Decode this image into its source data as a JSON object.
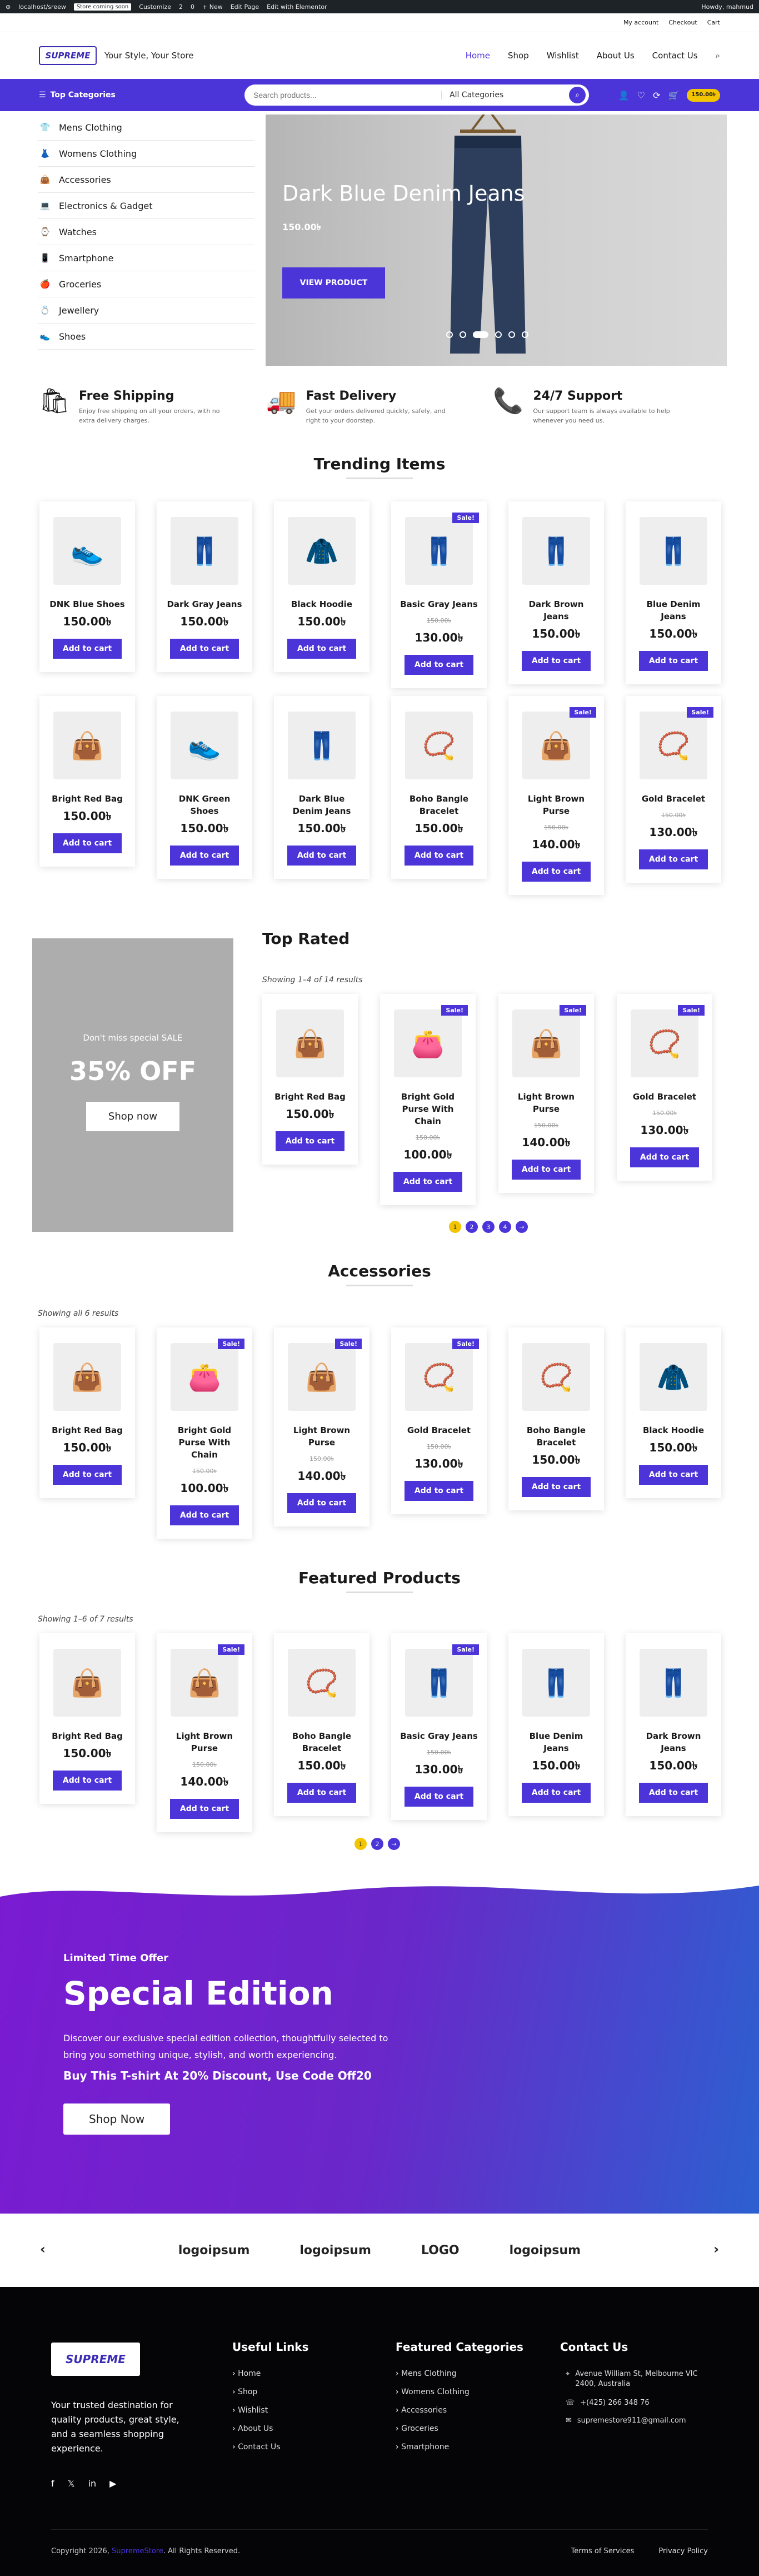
{
  "adminbar": {
    "site": "localhost/sreew",
    "badge": "Store coming soon",
    "customize": "Customize",
    "updates": "2",
    "comments": "0",
    "new": "+ New",
    "edit_page": "Edit Page",
    "elementor": "Edit with Elementor",
    "howdy": "Howdy, mahmud"
  },
  "util": {
    "my_account": "My account",
    "checkout": "Checkout",
    "cart": "Cart"
  },
  "header": {
    "logo": "SUPREME",
    "tagline": "Your Style, Your Store",
    "nav": [
      "Home",
      "Shop",
      "Wishlist",
      "About Us",
      "Contact Us"
    ]
  },
  "catbar": {
    "top_categories": "Top Categories",
    "search_placeholder": "Search products...",
    "select": "All Categories",
    "cart_amount": "150.00৳"
  },
  "categories": [
    {
      "label": "Mens Clothing",
      "icon": "👕"
    },
    {
      "label": "Womens Clothing",
      "icon": "👗"
    },
    {
      "label": "Accessories",
      "icon": "👜"
    },
    {
      "label": "Electronics & Gadget",
      "icon": "💻"
    },
    {
      "label": "Watches",
      "icon": "⌚"
    },
    {
      "label": "Smartphone",
      "icon": "📱"
    },
    {
      "label": "Groceries",
      "icon": "🍎"
    },
    {
      "label": "Jewellery",
      "icon": "💍"
    },
    {
      "label": "Shoes",
      "icon": "👟"
    }
  ],
  "hero": {
    "title": "Dark Blue Denim Jeans",
    "price": "150.00৳",
    "button": "VIEW PRODUCT"
  },
  "features": [
    {
      "title": "Free Shipping",
      "desc": "Enjoy free shipping on all your orders, with no extra delivery charges.",
      "icon": "🛍"
    },
    {
      "title": "Fast Delivery",
      "desc": "Get your orders delivered quickly, safely, and right to your doorstep.",
      "icon": "🚚"
    },
    {
      "title": "24/7 Support",
      "desc": "Our support team is always available to help whenever you need us.",
      "icon": "📞"
    }
  ],
  "trending": {
    "title": "Trending Items",
    "products": [
      {
        "name": "DNK Blue Shoes",
        "price": "150.00৳",
        "old": "",
        "sale": false,
        "icon": "👟"
      },
      {
        "name": "Dark Gray Jeans",
        "price": "150.00৳",
        "old": "",
        "sale": false,
        "icon": "👖"
      },
      {
        "name": "Black Hoodie",
        "price": "150.00৳",
        "old": "",
        "sale": false,
        "icon": "🧥"
      },
      {
        "name": "Basic Gray Jeans",
        "price": "130.00৳",
        "old": "150.00৳",
        "sale": true,
        "icon": "👖"
      },
      {
        "name": "Dark Brown Jeans",
        "price": "150.00৳",
        "old": "",
        "sale": false,
        "icon": "👖"
      },
      {
        "name": "Blue Denim Jeans",
        "price": "150.00৳",
        "old": "",
        "sale": false,
        "icon": "👖"
      },
      {
        "name": "Bright Red Bag",
        "price": "150.00৳",
        "old": "",
        "sale": false,
        "icon": "👜"
      },
      {
        "name": "DNK Green Shoes",
        "price": "150.00৳",
        "old": "",
        "sale": false,
        "icon": "👟"
      },
      {
        "name": "Dark Blue Denim Jeans",
        "price": "150.00৳",
        "old": "",
        "sale": false,
        "icon": "👖"
      },
      {
        "name": "Boho Bangle Bracelet",
        "price": "150.00৳",
        "old": "",
        "sale": false,
        "icon": "📿"
      },
      {
        "name": "Light Brown Purse",
        "price": "140.00৳",
        "old": "150.00৳",
        "sale": true,
        "icon": "👜"
      },
      {
        "name": "Gold Bracelet",
        "price": "130.00৳",
        "old": "150.00৳",
        "sale": true,
        "icon": "📿"
      }
    ]
  },
  "promo": {
    "text": "Don't miss special SALE",
    "percent": "35% OFF",
    "button": "Shop now"
  },
  "top_rated": {
    "title": "Top Rated",
    "showing": "Showing 1–4 of 14 results",
    "products": [
      {
        "name": "Bright Red Bag",
        "price": "150.00৳",
        "old": "",
        "sale": false,
        "icon": "👜"
      },
      {
        "name": "Bright Gold Purse With Chain",
        "price": "100.00৳",
        "old": "150.00৳",
        "sale": true,
        "icon": "👛"
      },
      {
        "name": "Light Brown Purse",
        "price": "140.00৳",
        "old": "150.00৳",
        "sale": true,
        "icon": "👜"
      },
      {
        "name": "Gold Bracelet",
        "price": "130.00৳",
        "old": "150.00৳",
        "sale": true,
        "icon": "📿"
      }
    ],
    "pages": [
      "1",
      "2",
      "3",
      "4",
      "→"
    ]
  },
  "accessories": {
    "title": "Accessories",
    "showing": "Showing all 6 results",
    "products": [
      {
        "name": "Bright Red Bag",
        "price": "150.00৳",
        "old": "",
        "sale": false,
        "icon": "👜"
      },
      {
        "name": "Bright Gold Purse With Chain",
        "price": "100.00৳",
        "old": "150.00৳",
        "sale": true,
        "icon": "👛"
      },
      {
        "name": "Light Brown Purse",
        "price": "140.00৳",
        "old": "150.00৳",
        "sale": true,
        "icon": "👜"
      },
      {
        "name": "Gold Bracelet",
        "price": "130.00৳",
        "old": "150.00৳",
        "sale": true,
        "icon": "📿"
      },
      {
        "name": "Boho Bangle Bracelet",
        "price": "150.00৳",
        "old": "",
        "sale": false,
        "icon": "📿"
      },
      {
        "name": "Black Hoodie",
        "price": "150.00৳",
        "old": "",
        "sale": false,
        "icon": "🧥"
      }
    ]
  },
  "featured": {
    "title": "Featured Products",
    "showing": "Showing 1–6 of 7 results",
    "products": [
      {
        "name": "Bright Red Bag",
        "price": "150.00৳",
        "old": "",
        "sale": false,
        "icon": "👜"
      },
      {
        "name": "Light Brown Purse",
        "price": "140.00৳",
        "old": "150.00৳",
        "sale": true,
        "icon": "👜"
      },
      {
        "name": "Boho Bangle Bracelet",
        "price": "150.00৳",
        "old": "",
        "sale": false,
        "icon": "📿"
      },
      {
        "name": "Basic Gray Jeans",
        "price": "130.00৳",
        "old": "150.00৳",
        "sale": true,
        "icon": "👖"
      },
      {
        "name": "Blue Denim Jeans",
        "price": "150.00৳",
        "old": "",
        "sale": false,
        "icon": "👖"
      },
      {
        "name": "Dark Brown Jeans",
        "price": "150.00৳",
        "old": "",
        "sale": false,
        "icon": "👖"
      }
    ],
    "pages": [
      "1",
      "2",
      "→"
    ]
  },
  "labels": {
    "add_to_cart": "Add to cart",
    "sale": "Sale!"
  },
  "special": {
    "label": "Limited Time Offer",
    "title": "Special Edition",
    "desc": "Discover our exclusive special edition collection, thoughtfully selected to bring you something unique, stylish, and worth experiencing.",
    "code": "Buy This T-shirt At 20% Discount, Use Code Off20",
    "button": "Shop Now"
  },
  "logos": [
    "logoipsum",
    "logoipsum",
    "LOGO",
    "logoipsum"
  ],
  "footer": {
    "logo": "SUPREME",
    "desc": "Your trusted destination for quality products, great style, and a seamless shopping experience.",
    "useful_title": "Useful Links",
    "useful": [
      "Home",
      "Shop",
      "Wishlist",
      "About Us",
      "Contact Us"
    ],
    "featured_title": "Featured Categories",
    "featured": [
      "Mens Clothing",
      "Womens Clothing",
      "Accessories",
      "Groceries",
      "Smartphone"
    ],
    "contact_title": "Contact Us",
    "address": "Avenue William St, Melbourne VIC 2400, Australia",
    "phone": "+(425) 266 348 76",
    "email": "supremestore911@gmail.com",
    "copyright_pre": "Copyright 2026,",
    "copyright_brand": "SupremeStore",
    "copyright_post": ". All Rights Reserved.",
    "terms": "Terms of Services",
    "privacy": "Privacy Policy"
  }
}
